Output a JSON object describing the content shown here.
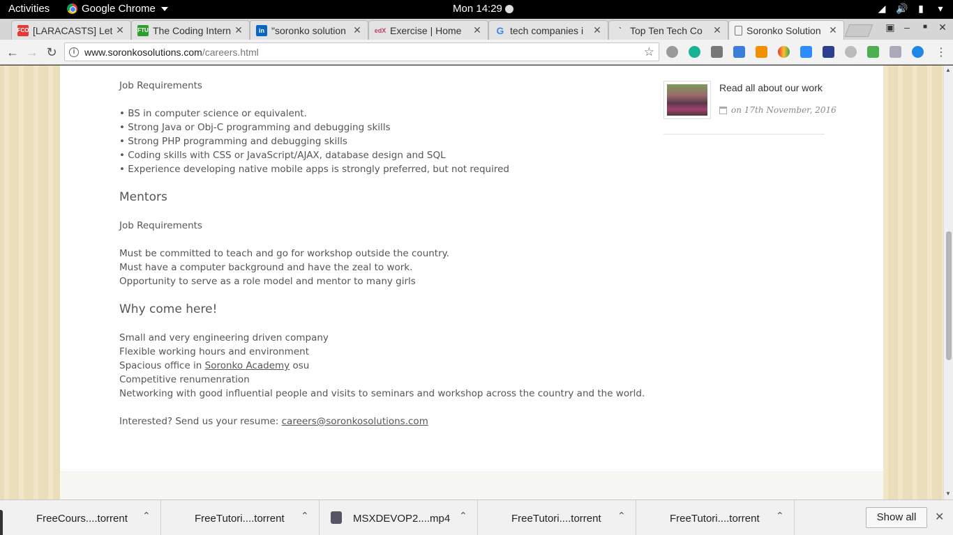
{
  "topbar": {
    "activities": "Activities",
    "app_name": "Google Chrome",
    "clock": "Mon 14:29"
  },
  "tabs": [
    {
      "label": "[LARACASTS] Let",
      "favicon": "FCO",
      "color": "#e53935"
    },
    {
      "label": "The Coding Intern",
      "favicon": "FTU",
      "color": "#2e9d2e"
    },
    {
      "label": "\"soronko solution",
      "favicon": "in",
      "color": "#0a66c2"
    },
    {
      "label": "Exercise | Home",
      "favicon": "edX",
      "color": "#c23b6b"
    },
    {
      "label": "tech companies i",
      "favicon": "G",
      "color": "#4285f4"
    },
    {
      "label": "Top Ten Tech Co",
      "favicon": "`",
      "color": "#777777"
    },
    {
      "label": "Soronko Solution",
      "favicon": "page",
      "color": "#777777"
    }
  ],
  "address": {
    "host": "www.soronkosolutions.com",
    "path": "/careers.html"
  },
  "article": {
    "dev_req_heading": "Job Requirements",
    "dev_req_items": [
      "• BS in computer science or equivalent.",
      "• Strong Java or Obj-C programming and debugging skills",
      "• Strong PHP programming and debugging skills",
      "• Coding skills with CSS or JavaScript/AJAX, database design and SQL",
      "• Experience developing native mobile apps is strongly preferred, but not required"
    ],
    "mentors_title": "Mentors",
    "mentors_req_heading": "Job Requirements",
    "mentors_items": [
      "Must be committed to teach and go for workshop outside the country.",
      "Must have a computer background and have the zeal to work.",
      "Opportunity to serve as a role model and mentor to many girls"
    ],
    "why_title": "Why come here!",
    "why_items": [
      "Small and very engineering driven company",
      "Flexible working hours and environment"
    ],
    "office_prefix": "Spacious office in ",
    "office_link": "Soronko Academy",
    "office_suffix": " osu",
    "why_items_after": [
      "Competitive renumenration",
      "Networking with good influential people and visits to seminars and workshop across the country and the world."
    ],
    "interested_prefix": "Interested? Send us your resume: ",
    "email": "careers@soronkosolutions.com"
  },
  "sidebar": {
    "post_title": "Read all about our work",
    "post_date": "on 17th November, 2016"
  },
  "downloads": {
    "items": [
      "FreeCours....torrent",
      "FreeTutori....torrent",
      "MSXDEVOP2....mp4",
      "FreeTutori....torrent",
      "FreeTutori....torrent"
    ],
    "show_all": "Show all"
  }
}
